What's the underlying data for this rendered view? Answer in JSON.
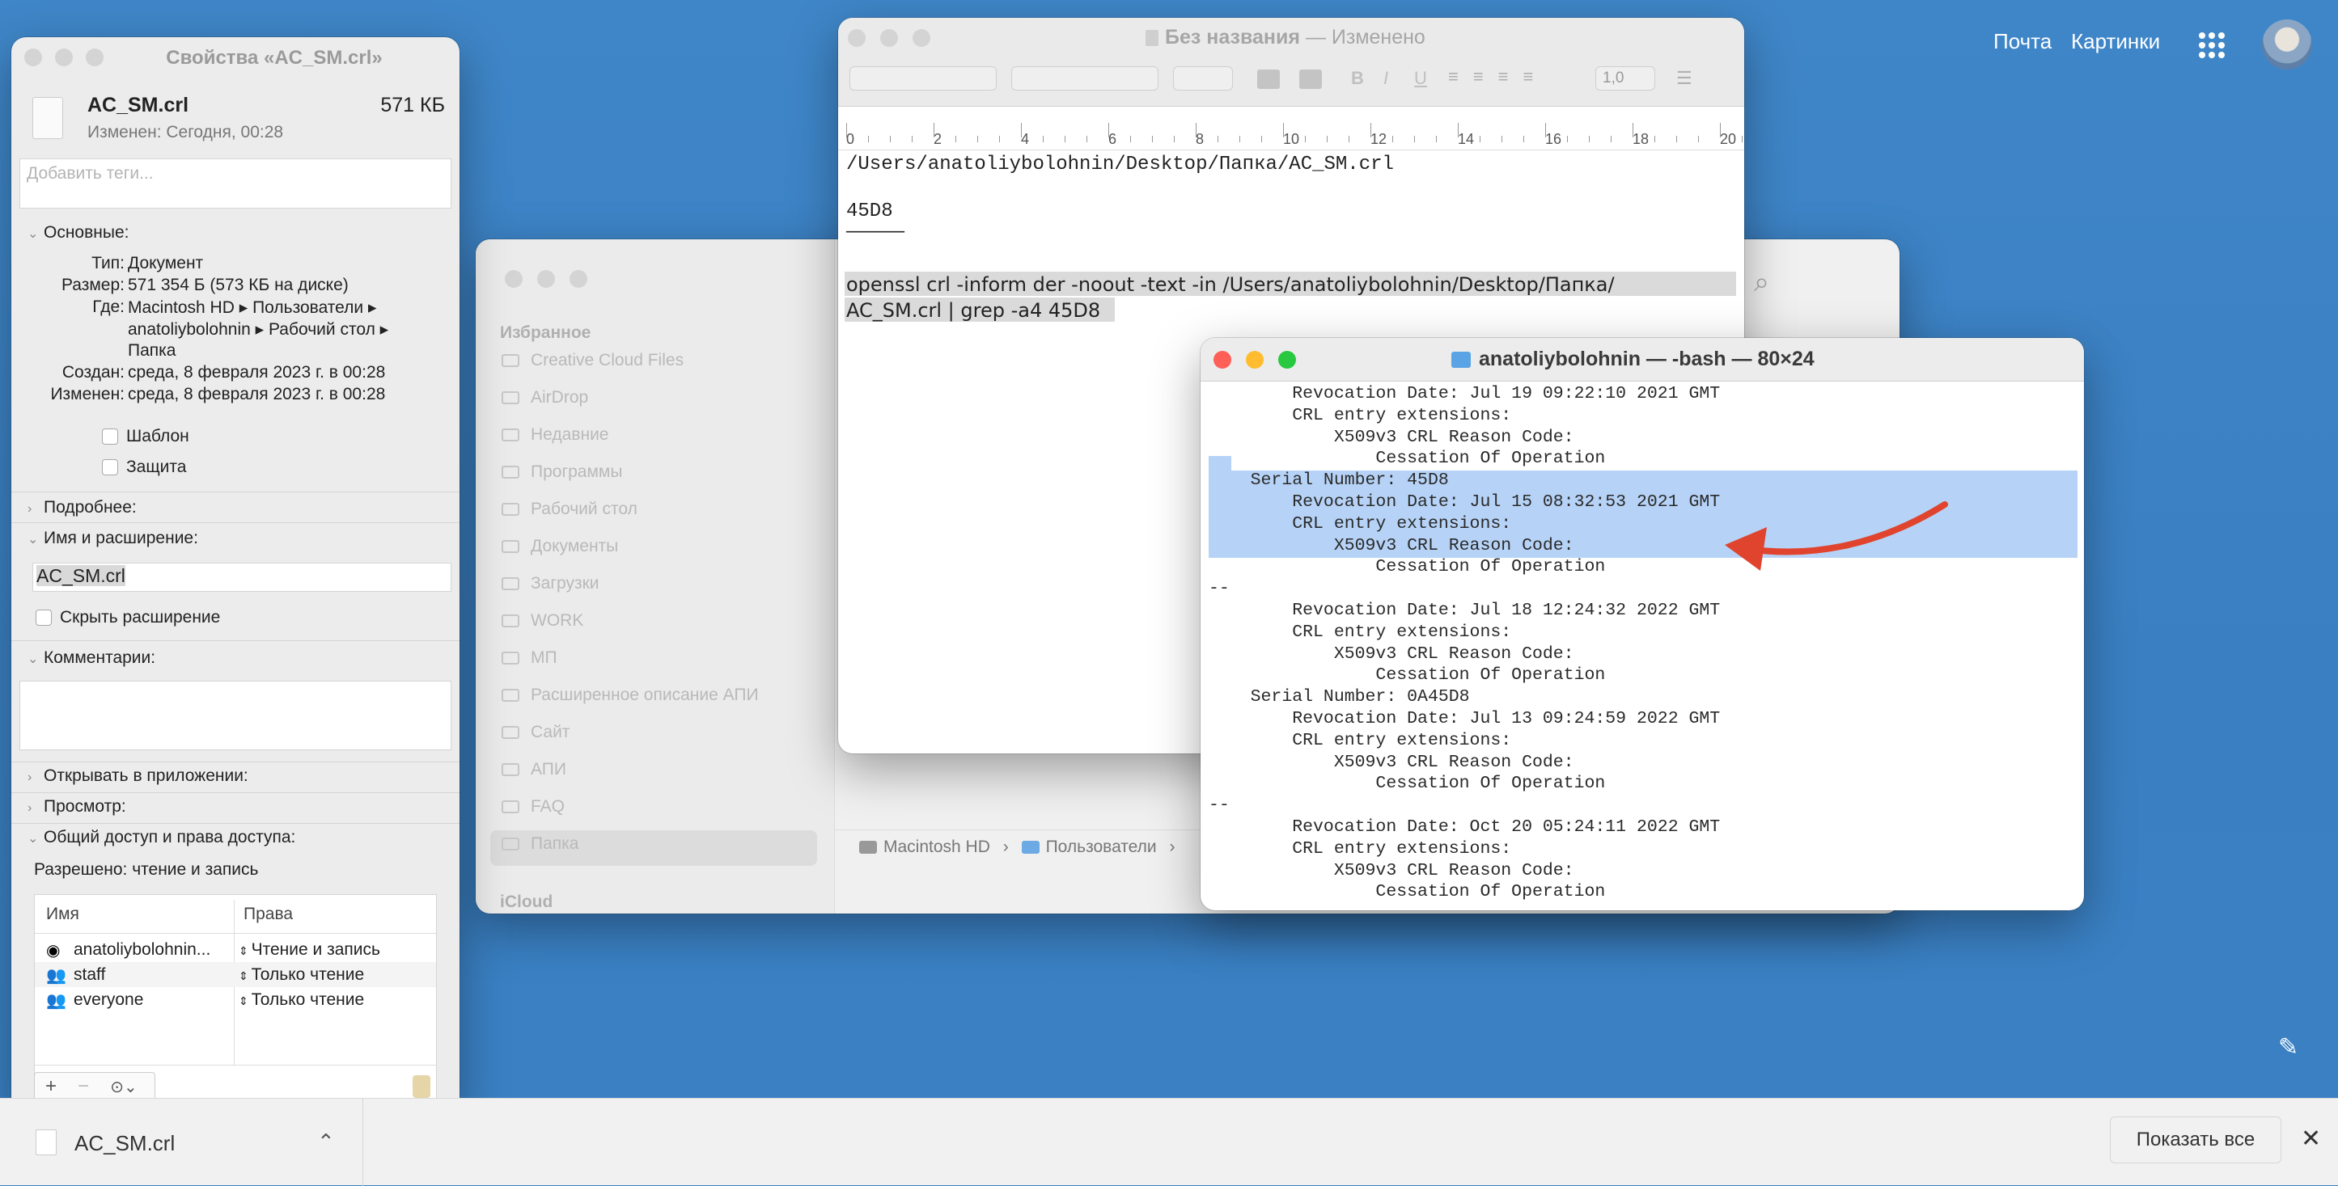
{
  "google": {
    "mail": "Почта",
    "images": "Картинки"
  },
  "info": {
    "title": "Свойства «AC_SM.crl»",
    "file_name": "AC_SM.crl",
    "file_size": "571 КБ",
    "modified_short": "Изменен: Сегодня, 00:28",
    "tags_placeholder": "Добавить теги...",
    "general_label": "Основные:",
    "kind_k": "Тип:",
    "kind_v": "Документ",
    "size_k": "Размер:",
    "size_v": "571 354 Б (573 КБ на диске)",
    "where_k": "Где:",
    "where_v1": "Macintosh HD ▸ Пользователи ▸",
    "where_v2": "anatoliybolohnin ▸ Рабочий стол ▸",
    "where_v3": "Папка",
    "created_k": "Создан:",
    "created_v": "среда, 8 февраля 2023 г. в 00:28",
    "modified_k": "Изменен:",
    "modified_v": "среда, 8 февраля 2023 г. в 00:28",
    "stationery": "Шаблон",
    "locked": "Защита",
    "more_info": "Подробнее:",
    "name_ext": "Имя и расширение:",
    "name_value": "AC_SM.crl",
    "hide_ext": "Скрыть расширение",
    "comments": "Комментарии:",
    "open_with": "Открывать в приложении:",
    "preview": "Просмотр:",
    "sharing": "Общий доступ и права доступа:",
    "permissions_summary": "Разрешено: чтение и запись",
    "col_name": "Имя",
    "col_priv": "Права",
    "perm_rows": [
      {
        "name": "anatoliybolohnin...",
        "priv": "Чтение и запись"
      },
      {
        "name": "staff",
        "priv": "Только чтение"
      },
      {
        "name": "everyone",
        "priv": "Только чтение"
      }
    ],
    "btn_add": "+",
    "btn_remove": "−"
  },
  "finder": {
    "favorites": "Избранное",
    "items": [
      "Creative Cloud Files",
      "AirDrop",
      "Недавние",
      "Программы",
      "Рабочий стол",
      "Документы",
      "Загрузки",
      "WORK",
      "МП",
      "Расширенное описание АПИ",
      "Сайт",
      "АПИ",
      "FAQ",
      "Папка"
    ],
    "icloud": "iCloud",
    "path": [
      "Macintosh HD",
      "Пользователи"
    ]
  },
  "textedit": {
    "title": "Без названия",
    "edited": "— Изменено",
    "font_size": "1,0",
    "ruler": [
      "0",
      "2",
      "4",
      "6",
      "8",
      "10",
      "12",
      "14",
      "16",
      "18",
      "20"
    ],
    "line1": "/Users/anatoliybolohnin/Desktop/Папка/AC_SM.crl",
    "line2": "45D8",
    "line3": "—————",
    "cmd1": "openssl crl -inform der -noout -text -in /Users/anatoliybolohnin/Desktop/Папка/",
    "cmd2": "AC_SM.crl | grep -a4 45D8"
  },
  "terminal": {
    "title": "anatoliybolohnin — -bash — 80×24",
    "lines": [
      "        Revocation Date: Jul 19 09:22:10 2021 GMT",
      "        CRL entry extensions:",
      "            X509v3 CRL Reason Code:",
      "                Cessation Of Operation",
      "    Serial Number: 45D8",
      "        Revocation Date: Jul 15 08:32:53 2021 GMT",
      "        CRL entry extensions:",
      "            X509v3 CRL Reason Code:",
      "                Cessation Of Operation",
      "--",
      "        Revocation Date: Jul 18 12:24:32 2022 GMT",
      "        CRL entry extensions:",
      "            X509v3 CRL Reason Code:",
      "                Cessation Of Operation",
      "    Serial Number: 0A45D8",
      "        Revocation Date: Jul 13 09:24:59 2022 GMT",
      "        CRL entry extensions:",
      "            X509v3 CRL Reason Code:",
      "                Cessation Of Operation",
      "--",
      "        Revocation Date: Oct 20 05:24:11 2022 GMT",
      "        CRL entry extensions:",
      "            X509v3 CRL Reason Code:",
      "                Cessation Of Operation"
    ]
  },
  "download": {
    "file": "AC_SM.crl",
    "show_all": "Показать все"
  },
  "colors": {
    "highlight": "#b6d3f7",
    "arrow": "#e0442e",
    "close": "#fe5f57",
    "min": "#febc2e",
    "max": "#28c840"
  }
}
